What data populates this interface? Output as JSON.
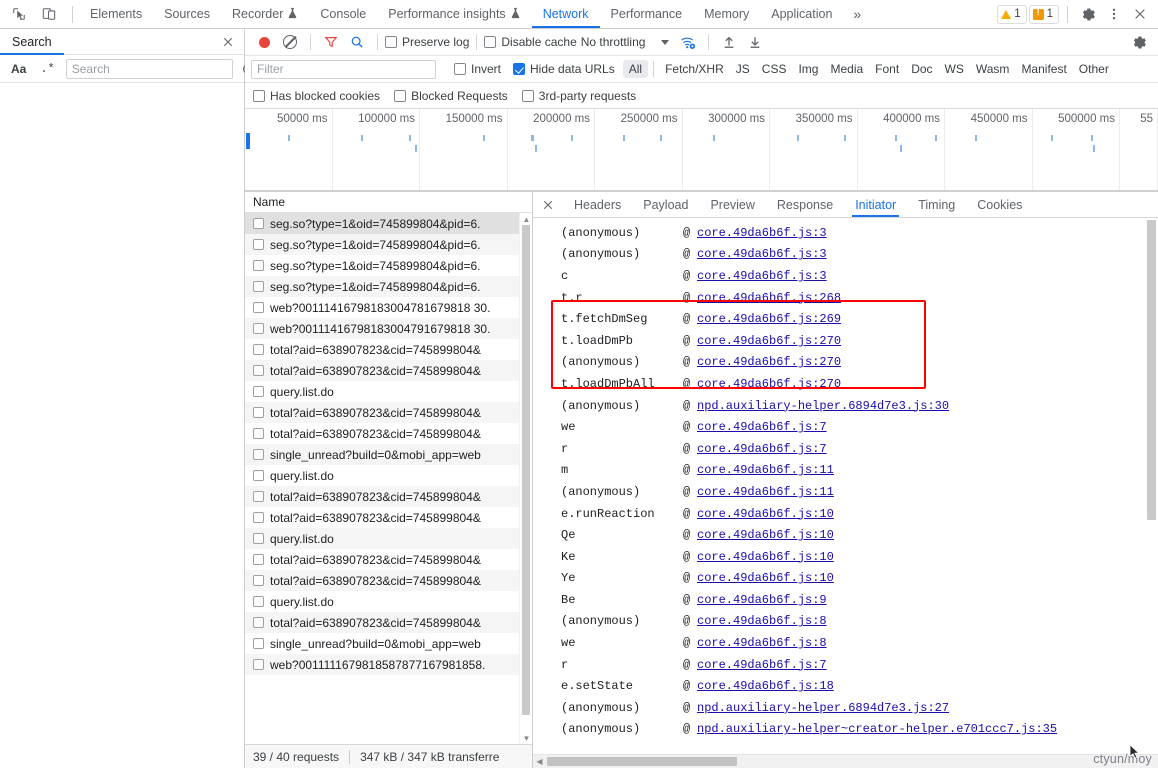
{
  "window": {
    "title": "DevTools - Network"
  },
  "main_tabbar": {
    "icons": [
      {
        "name": "inspect-element-icon",
        "glyph": "inspect"
      },
      {
        "name": "device-toolbar-icon",
        "glyph": "device"
      }
    ],
    "tabs": [
      {
        "label": "Elements",
        "selected": false,
        "flask": false
      },
      {
        "label": "Sources",
        "selected": false,
        "flask": false
      },
      {
        "label": "Recorder",
        "selected": false,
        "flask": true
      },
      {
        "label": "Console",
        "selected": false,
        "flask": false
      },
      {
        "label": "Performance insights",
        "selected": false,
        "flask": true
      },
      {
        "label": "Network",
        "selected": true,
        "flask": false
      },
      {
        "label": "Performance",
        "selected": false,
        "flask": false
      },
      {
        "label": "Memory",
        "selected": false,
        "flask": false
      },
      {
        "label": "Application",
        "selected": false,
        "flask": false
      }
    ],
    "more_label": "»",
    "warning_count": "1",
    "error_count": "1",
    "settings_icon": "gear-icon",
    "more_options_icon": "kebab-menu-icon",
    "close_icon": "close-icon"
  },
  "search_drawer": {
    "tab_label": "Search",
    "close_icon": "close-icon",
    "match_case_label": "Aa",
    "regex_label": ".*",
    "input_placeholder": "Search",
    "input_value": "",
    "refresh_icon": "refresh-icon",
    "clear_icon": "clear-icon"
  },
  "network_toolbar": {
    "record_label": "record-button",
    "clear_label": "clear-button",
    "filter_icon": "funnel-icon",
    "search_icon": "search-icon",
    "preserve_log_label": "Preserve log",
    "preserve_log_checked": false,
    "disable_cache_label": "Disable cache",
    "disable_cache_checked": false,
    "throttling_value": "No throttling",
    "wifi_icon": "wifi-settings-icon",
    "import_icon": "upload-har-icon",
    "export_icon": "download-har-icon",
    "settings_icon": "gear-icon"
  },
  "filter_bar": {
    "filter_placeholder": "Filter",
    "filter_value": "",
    "invert_label": "Invert",
    "invert_checked": false,
    "hide_data_urls_label": "Hide data URLs",
    "hide_data_urls_checked": true,
    "resource_types": [
      {
        "label": "All",
        "active": true
      },
      {
        "label": "Fetch/XHR",
        "active": false
      },
      {
        "label": "JS",
        "active": false
      },
      {
        "label": "CSS",
        "active": false
      },
      {
        "label": "Img",
        "active": false
      },
      {
        "label": "Media",
        "active": false
      },
      {
        "label": "Font",
        "active": false
      },
      {
        "label": "Doc",
        "active": false
      },
      {
        "label": "WS",
        "active": false
      },
      {
        "label": "Wasm",
        "active": false
      },
      {
        "label": "Manifest",
        "active": false
      },
      {
        "label": "Other",
        "active": false
      }
    ]
  },
  "options_row": {
    "has_blocked_cookies_label": "Has blocked cookies",
    "has_blocked_cookies_checked": false,
    "blocked_requests_label": "Blocked Requests",
    "blocked_requests_checked": false,
    "third_party_label": "3rd-party requests",
    "third_party_checked": false
  },
  "overview": {
    "ticks": [
      "50000 ms",
      "100000 ms",
      "150000 ms",
      "200000 ms",
      "250000 ms",
      "300000 ms",
      "350000 ms",
      "400000 ms",
      "450000 ms",
      "500000 ms",
      "55"
    ]
  },
  "requests_panel": {
    "column_header": "Name",
    "selected_index": 0,
    "rows": [
      "seg.so?type=1&oid=745899804&pid=6.",
      "seg.so?type=1&oid=745899804&pid=6.",
      "seg.so?type=1&oid=745899804&pid=6.",
      "seg.so?type=1&oid=745899804&pid=6.",
      "web?00111416798183004781679818 30.",
      "web?00111416798183004791679818 30.",
      "total?aid=638907823&cid=745899804&",
      "total?aid=638907823&cid=745899804&",
      "query.list.do",
      "total?aid=638907823&cid=745899804&",
      "total?aid=638907823&cid=745899804&",
      "single_unread?build=0&mobi_app=web",
      "query.list.do",
      "total?aid=638907823&cid=745899804&",
      "total?aid=638907823&cid=745899804&",
      "query.list.do",
      "total?aid=638907823&cid=745899804&",
      "total?aid=638907823&cid=745899804&",
      "query.list.do",
      "total?aid=638907823&cid=745899804&",
      "single_unread?build=0&mobi_app=web",
      "web?0011111679818587877167981858."
    ],
    "status": {
      "requests": "39 / 40 requests",
      "transferred": "347 kB / 347 kB transferre"
    }
  },
  "detail_panel": {
    "close_icon": "close-icon",
    "tabs": [
      {
        "label": "Headers",
        "selected": false
      },
      {
        "label": "Payload",
        "selected": false
      },
      {
        "label": "Preview",
        "selected": false
      },
      {
        "label": "Response",
        "selected": false
      },
      {
        "label": "Initiator",
        "selected": true
      },
      {
        "label": "Timing",
        "selected": false
      },
      {
        "label": "Cookies",
        "selected": false
      }
    ],
    "at_symbol": "@",
    "highlight_color": "#ff0000",
    "highlight_rows": [
      4,
      5,
      6,
      7
    ],
    "stack": [
      {
        "fn": "(anonymous)",
        "link": "core.49da6b6f.js:3"
      },
      {
        "fn": "(anonymous)",
        "link": "core.49da6b6f.js:3"
      },
      {
        "fn": "c",
        "link": "core.49da6b6f.js:3"
      },
      {
        "fn": "t.r",
        "link": "core.49da6b6f.js:268"
      },
      {
        "fn": "t.fetchDmSeg",
        "link": "core.49da6b6f.js:269"
      },
      {
        "fn": "t.loadDmPb",
        "link": "core.49da6b6f.js:270"
      },
      {
        "fn": "(anonymous)",
        "link": "core.49da6b6f.js:270"
      },
      {
        "fn": "t.loadDmPbAll",
        "link": "core.49da6b6f.js:270"
      },
      {
        "fn": "(anonymous)",
        "link": "npd.auxiliary-helper.6894d7e3.js:30"
      },
      {
        "fn": "we",
        "link": "core.49da6b6f.js:7"
      },
      {
        "fn": "r",
        "link": "core.49da6b6f.js:7"
      },
      {
        "fn": "m",
        "link": "core.49da6b6f.js:11"
      },
      {
        "fn": "(anonymous)",
        "link": "core.49da6b6f.js:11"
      },
      {
        "fn": "e.runReaction",
        "link": "core.49da6b6f.js:10"
      },
      {
        "fn": "Qe",
        "link": "core.49da6b6f.js:10"
      },
      {
        "fn": "Ke",
        "link": "core.49da6b6f.js:10"
      },
      {
        "fn": "Ye",
        "link": "core.49da6b6f.js:10"
      },
      {
        "fn": "Be",
        "link": "core.49da6b6f.js:9"
      },
      {
        "fn": "(anonymous)",
        "link": "core.49da6b6f.js:8"
      },
      {
        "fn": "we",
        "link": "core.49da6b6f.js:8"
      },
      {
        "fn": "r",
        "link": "core.49da6b6f.js:7"
      },
      {
        "fn": "e.setState",
        "link": "core.49da6b6f.js:18"
      },
      {
        "fn": "(anonymous)",
        "link": "npd.auxiliary-helper.6894d7e3.js:27"
      },
      {
        "fn": "(anonymous)",
        "link": "npd.auxiliary-helper~creator-helper.e701ccc7.js:35"
      }
    ]
  },
  "watermark": {
    "text": "ctyun/moy"
  }
}
